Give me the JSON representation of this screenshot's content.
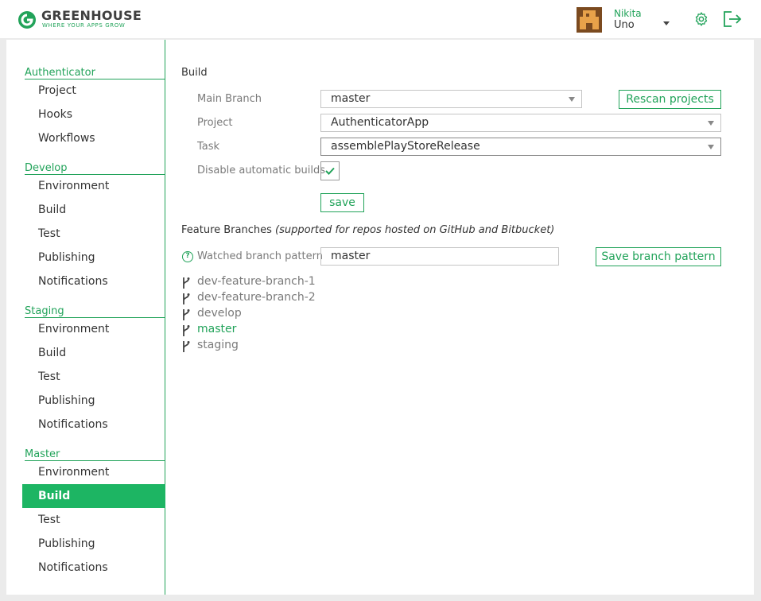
{
  "app": {
    "name": "GREENHOUSE",
    "tagline": "WHERE YOUR APPS GROW"
  },
  "user": {
    "first_name": "Nikita",
    "last_name": "Uno"
  },
  "colors": {
    "accent": "#22a35a",
    "active_bg": "#1db563"
  },
  "sidebar": {
    "sections": [
      {
        "title": "Authenticator",
        "items": [
          "Project",
          "Hooks",
          "Workflows"
        ]
      },
      {
        "title": "Develop",
        "items": [
          "Environment",
          "Build",
          "Test",
          "Publishing",
          "Notifications"
        ]
      },
      {
        "title": "Staging",
        "items": [
          "Environment",
          "Build",
          "Test",
          "Publishing",
          "Notifications"
        ]
      },
      {
        "title": "Master",
        "items": [
          "Environment",
          "Build",
          "Test",
          "Publishing",
          "Notifications"
        ]
      }
    ],
    "active": "Master / Build"
  },
  "build": {
    "title": "Build",
    "main_branch_label": "Main Branch",
    "main_branch_value": "master",
    "rescan_label": "Rescan projects",
    "project_label": "Project",
    "project_value": "AuthenticatorApp",
    "task_label": "Task",
    "task_value": "assemblePlayStoreRelease",
    "disable_label": "Disable automatic builds",
    "disable_checked": true,
    "save_label": "save"
  },
  "feature": {
    "title": "Feature Branches",
    "note": "(supported for repos hosted on GitHub and Bitbucket)",
    "watched_label": "Watched branch pattern",
    "watched_value": "master",
    "save_pattern_label": "Save branch pattern",
    "branches": [
      {
        "name": "dev-feature-branch-1",
        "matched": false
      },
      {
        "name": "dev-feature-branch-2",
        "matched": false
      },
      {
        "name": "develop",
        "matched": false
      },
      {
        "name": "master",
        "matched": true
      },
      {
        "name": "staging",
        "matched": false
      }
    ]
  }
}
